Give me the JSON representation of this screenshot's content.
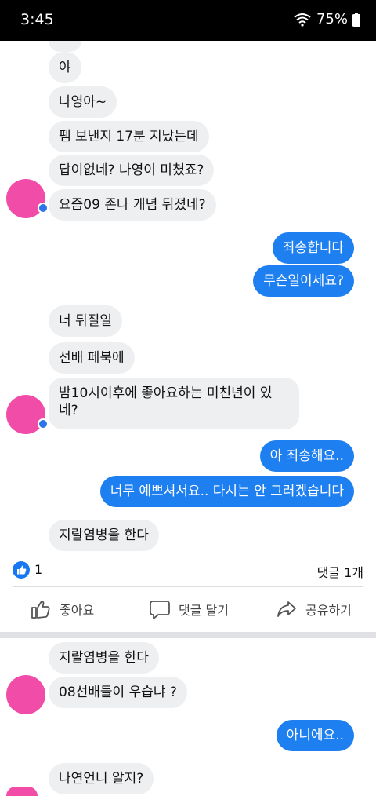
{
  "status_bar": {
    "time": "3:45",
    "battery": "75%"
  },
  "messages_top": [
    {
      "text": "야",
      "side": "in"
    },
    {
      "text": "나영아~",
      "side": "in"
    },
    {
      "text": "펨 보낸지 17분 지났는데",
      "side": "in"
    },
    {
      "text": "답이없네? 나영이 미쳤죠?",
      "side": "in"
    },
    {
      "text": "요즘09 존나 개념 뒤졌네?",
      "side": "in"
    },
    {
      "text": "죄송합니다",
      "side": "out"
    },
    {
      "text": "무슨일이세요?",
      "side": "out"
    },
    {
      "text": "너 뒤질일",
      "side": "in"
    },
    {
      "text": "선배 페북에",
      "side": "in"
    },
    {
      "text": "밤10시이후에 좋아요하는 미친년이 있",
      "side": "in"
    },
    {
      "text": "네?",
      "side": "in"
    },
    {
      "text": "아 죄송해요..",
      "side": "out"
    },
    {
      "text": "너무 예쁘셔서요.. 다시는 안 그러겠습니다",
      "side": "out"
    },
    {
      "text": "지랄염병을 한다",
      "side": "in"
    }
  ],
  "post": {
    "like_count": "1",
    "comment_count": "댓글 1개",
    "actions": {
      "like": "좋아요",
      "comment": "댓글 달기",
      "share": "공유하기"
    }
  },
  "messages_bottom": [
    {
      "text": "지랄염병을 한다",
      "side": "in"
    },
    {
      "text": "08선배들이 우습냐 ?",
      "side": "in"
    },
    {
      "text": "아니에요..",
      "side": "out"
    },
    {
      "text": "나연언니 알지?",
      "side": "in"
    }
  ],
  "colors": {
    "outgoing": "#1d7ff0",
    "incoming": "#eeeff1",
    "like_blue": "#1877f2",
    "avatar_censor": "#f14ca8"
  }
}
